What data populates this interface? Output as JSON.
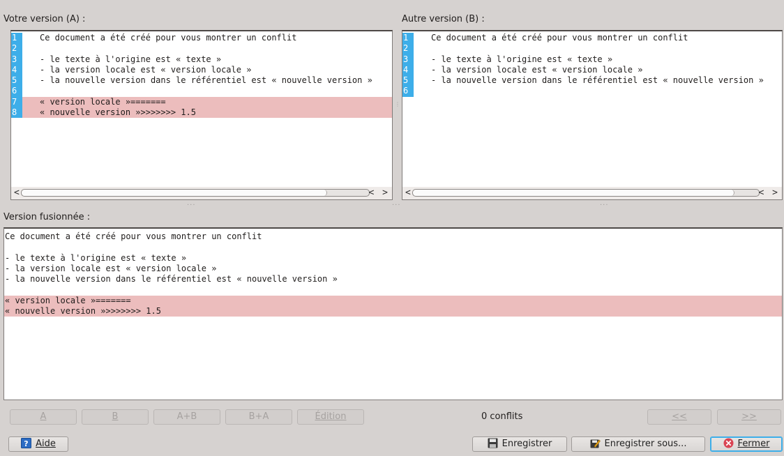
{
  "pane_a": {
    "title": "Votre version (A) :",
    "lines": [
      {
        "n": "1",
        "text": "Ce document a été créé pour vous montrer un conflit",
        "conflict": false
      },
      {
        "n": "2",
        "text": "",
        "conflict": false
      },
      {
        "n": "3",
        "text": "- le texte à l'origine est « texte »",
        "conflict": false
      },
      {
        "n": "4",
        "text": "- la version locale est « version locale »",
        "conflict": false
      },
      {
        "n": "5",
        "text": "- la nouvelle version dans le référentiel est « nouvelle version »",
        "conflict": false
      },
      {
        "n": "6",
        "text": "",
        "conflict": false
      },
      {
        "n": "7",
        "text": "« version locale »=======",
        "conflict": true
      },
      {
        "n": "8",
        "text": "« nouvelle version »>>>>>>> 1.5",
        "conflict": true
      }
    ],
    "scroll_left": "<",
    "scroll_right": "< >"
  },
  "pane_b": {
    "title": "Autre version (B) :",
    "lines": [
      {
        "n": "1",
        "text": "Ce document a été créé pour vous montrer un conflit",
        "conflict": false
      },
      {
        "n": "2",
        "text": "",
        "conflict": false
      },
      {
        "n": "3",
        "text": "- le texte à l'origine est « texte »",
        "conflict": false
      },
      {
        "n": "4",
        "text": "- la version locale est « version locale »",
        "conflict": false
      },
      {
        "n": "5",
        "text": "- la nouvelle version dans le référentiel est « nouvelle version »",
        "conflict": false
      },
      {
        "n": "6",
        "text": "",
        "conflict": false
      }
    ],
    "scroll_left": "<",
    "scroll_right": "< >"
  },
  "merged": {
    "title": "Version fusionnée :",
    "lines": [
      {
        "text": "Ce document a été créé pour vous montrer un conflit",
        "conflict": false
      },
      {
        "text": "",
        "conflict": false
      },
      {
        "text": "- le texte à l'origine est « texte »",
        "conflict": false
      },
      {
        "text": "- la version locale est « version locale »",
        "conflict": false
      },
      {
        "text": "- la nouvelle version dans le référentiel est « nouvelle version »",
        "conflict": false
      },
      {
        "text": "",
        "conflict": false
      },
      {
        "text": "« version locale »=======",
        "conflict": true
      },
      {
        "text": "« nouvelle version »>>>>>>> 1.5",
        "conflict": true
      }
    ]
  },
  "merge_buttons": {
    "a": "A",
    "b": "B",
    "a_plus_b": "A+B",
    "b_plus_a": "B+A",
    "edit": "Édition",
    "prev": "<<",
    "next": ">>"
  },
  "status": {
    "conflicts": "0 conflits"
  },
  "bottom_buttons": {
    "help": "Aide",
    "save": "Enregistrer",
    "save_as": "Enregistrer sous...",
    "close": "Fermer"
  },
  "icons": {
    "help": "help-icon",
    "save": "floppy-disk-icon",
    "save_as": "save-as-icon",
    "close": "close-icon"
  },
  "colors": {
    "line_number_bg": "#3daee9",
    "conflict_bg": "#ecbdbd",
    "window_bg": "#d6d2d0"
  }
}
